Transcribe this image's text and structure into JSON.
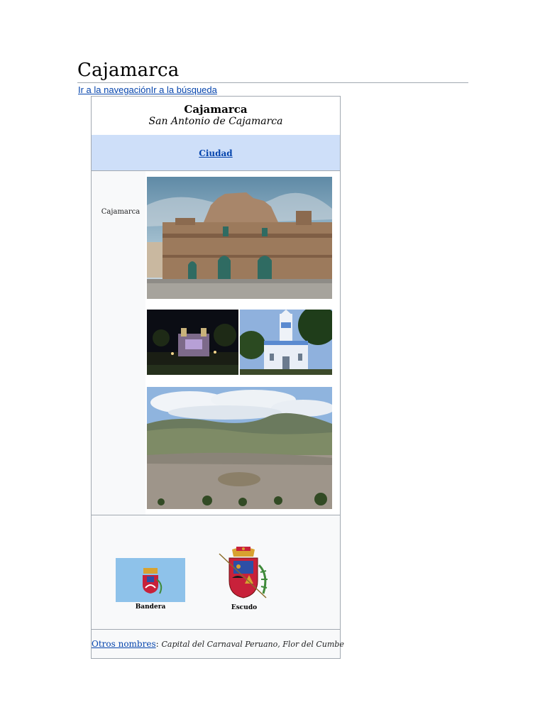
{
  "page": {
    "title": "Cajamarca",
    "jump_nav": "Ir a la navegación",
    "jump_search": "Ir a la búsqueda"
  },
  "infobox": {
    "name": "Cajamarca",
    "full_name": "San Antonio de Cajamarca",
    "entity_type": "Ciudad",
    "photo_caption": "Cajamarca",
    "flag_label": "Bandera",
    "shield_label": "Escudo",
    "other_names_label": "Otros nombres",
    "other_names_sep": ":",
    "other_names_value": "Capital del Carnaval Peruano, Flor del Cumbe"
  },
  "colors": {
    "link": "#0645ad",
    "header_band": "#cedff9",
    "infobox_bg": "#f8f9fa",
    "border": "#a2a9b1",
    "flag_blue": "#8ec2ea"
  }
}
